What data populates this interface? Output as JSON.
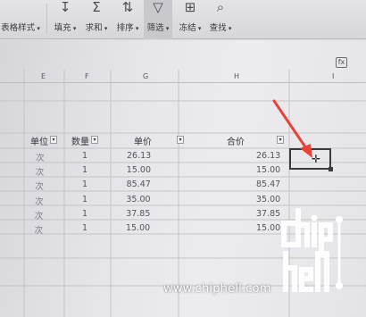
{
  "toolbar": {
    "left_partial_label": "表格样式",
    "buttons": [
      {
        "label": "填充",
        "icon": "fill-icon",
        "glyph": "↧"
      },
      {
        "label": "求和",
        "icon": "sum-icon",
        "glyph": "Σ"
      },
      {
        "label": "排序",
        "icon": "sort-icon",
        "glyph": "⇅"
      },
      {
        "label": "筛选",
        "icon": "filter-icon",
        "glyph": "▽"
      },
      {
        "label": "冻结",
        "icon": "freeze-icon",
        "glyph": "⊞"
      },
      {
        "label": "查找",
        "icon": "find-icon",
        "glyph": "⌕"
      }
    ]
  },
  "sheet": {
    "formula_icon": "fx",
    "column_letters": [
      "E",
      "F",
      "G",
      "H",
      "I"
    ],
    "headers": {
      "unit": "单位",
      "qty": "数量",
      "price": "单价",
      "total": "合价"
    },
    "rows": [
      {
        "unit": "次",
        "qty": "1",
        "price": "26.13",
        "total": "26.13"
      },
      {
        "unit": "次",
        "qty": "1",
        "price": "15.00",
        "total": "15.00"
      },
      {
        "unit": "次",
        "qty": "1",
        "price": "85.47",
        "total": "85.47"
      },
      {
        "unit": "次",
        "qty": "1",
        "price": "35.00",
        "total": "35.00"
      },
      {
        "unit": "次",
        "qty": "1",
        "price": "37.85",
        "total": "37.85"
      },
      {
        "unit": "次",
        "qty": "1",
        "price": "15.00",
        "total": "15.00"
      }
    ],
    "cursor_glyph": "✛",
    "accent_color": "#e8423a"
  },
  "watermark": {
    "text": "www.chiphell.com",
    "logo_text": "chiphell"
  }
}
